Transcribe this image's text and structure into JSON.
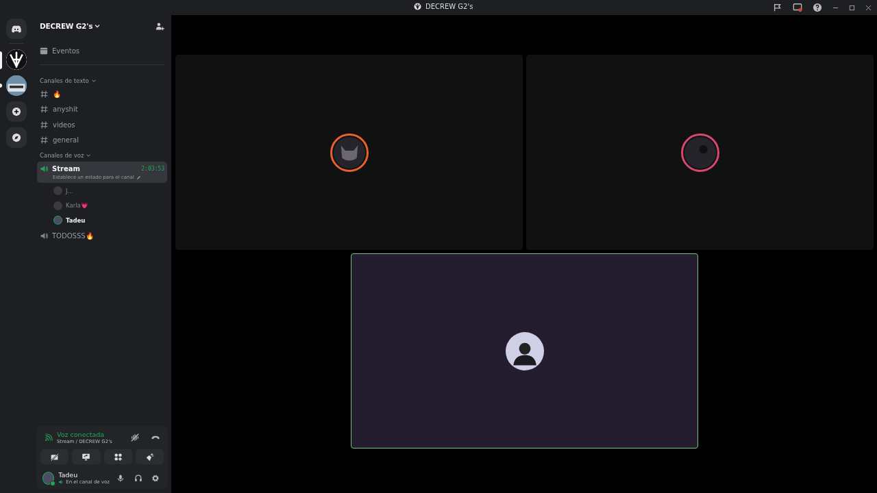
{
  "window": {
    "title": "DECREW G2's"
  },
  "servers": [
    {
      "kind": "home",
      "selected": false
    },
    {
      "kind": "server",
      "selected": true,
      "color": "#ffffff"
    },
    {
      "kind": "server",
      "selected": false,
      "color": "#6f8fa8"
    },
    {
      "kind": "add",
      "selected": false
    },
    {
      "kind": "discover",
      "selected": false
    }
  ],
  "server_name": "DECREW G2's",
  "events": "Eventos",
  "categories": [
    {
      "name": "Canales de texto",
      "channels": [
        {
          "kind": "text",
          "name": "🔥",
          "selected": false
        },
        {
          "kind": "text",
          "name": "anyshit",
          "selected": false
        },
        {
          "kind": "text",
          "name": "videos",
          "selected": false
        },
        {
          "kind": "text",
          "name": "general",
          "selected": false
        }
      ]
    },
    {
      "name": "Canales de voz",
      "channels": [
        {
          "kind": "voice",
          "name": "Stream",
          "selected": true,
          "timer": "2:03:53",
          "status": "Establece un estado para el canal",
          "members": [
            {
              "name": "J...",
              "speaking": false
            },
            {
              "name": "Karla💗",
              "speaking": false
            },
            {
              "name": "Tadeu",
              "speaking": true
            }
          ]
        },
        {
          "kind": "voice",
          "name": "TODOSSS🔥",
          "selected": false
        }
      ]
    }
  ],
  "voice_panel": {
    "status": "Voz conectada",
    "location": "Stream / DECREW G2's"
  },
  "user": {
    "name": "Tadeu",
    "status": "En el canal de voz"
  },
  "tiles": [
    {
      "speaking": false,
      "color": "#e8602c"
    },
    {
      "speaking": false,
      "color": "#d9466e"
    },
    {
      "speaking": true
    }
  ]
}
